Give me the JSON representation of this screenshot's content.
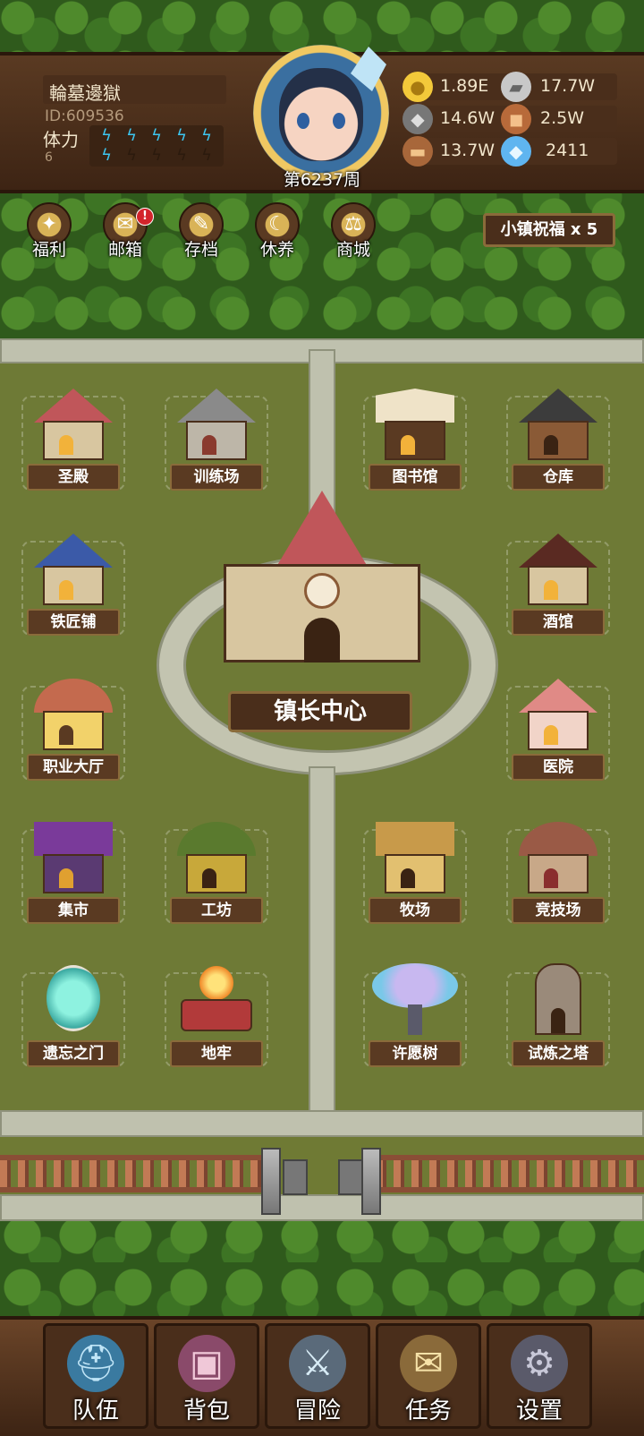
{
  "player": {
    "name": "輪墓邊獄",
    "id": "ID:609536",
    "stamina_label": "体力",
    "stamina_count": "6"
  },
  "week": "第6237周",
  "resources": [
    {
      "icon": "gold-coin-icon",
      "value": "1.89E"
    },
    {
      "icon": "iron-ingot-icon",
      "value": "17.7W"
    },
    {
      "icon": "stone-icon",
      "value": "14.6W"
    },
    {
      "icon": "leather-icon",
      "value": "2.5W"
    },
    {
      "icon": "wood-log-icon",
      "value": "13.7W"
    },
    {
      "icon": "crystal-icon",
      "value": "2411"
    }
  ],
  "menu": [
    {
      "label": "福利",
      "icon": "welfare-icon"
    },
    {
      "label": "邮箱",
      "icon": "mailbox-icon",
      "badge": "!"
    },
    {
      "label": "存档",
      "icon": "save-icon"
    },
    {
      "label": "休养",
      "icon": "rest-icon"
    },
    {
      "label": "商城",
      "icon": "shop-icon"
    }
  ],
  "blessing": "小镇祝福 x 5",
  "buildings": [
    {
      "label": "圣殿"
    },
    {
      "label": "训练场"
    },
    {
      "label": "图书馆"
    },
    {
      "label": "仓库"
    },
    {
      "label": "铁匠铺"
    },
    {
      "label": "酒馆"
    },
    {
      "label": "职业大厅"
    },
    {
      "label": "医院"
    },
    {
      "label": "集市"
    },
    {
      "label": "工坊"
    },
    {
      "label": "牧场"
    },
    {
      "label": "竞技场"
    },
    {
      "label": "遗忘之门"
    },
    {
      "label": "地牢"
    },
    {
      "label": "许愿树"
    },
    {
      "label": "试炼之塔"
    }
  ],
  "mayor_center": "镇长中心",
  "nav": [
    {
      "label": "队伍",
      "icon": "team-helmet-icon"
    },
    {
      "label": "背包",
      "icon": "backpack-icon"
    },
    {
      "label": "冒险",
      "icon": "crossed-swords-icon"
    },
    {
      "label": "任务",
      "icon": "quest-scroll-icon"
    },
    {
      "label": "设置",
      "icon": "settings-gear-icon"
    }
  ],
  "colors": {
    "wood_dark": "#4a2e1b",
    "grass": "#6e7a36",
    "road": "#bfc1ae",
    "stamina_bolt": "#3dc6f0",
    "badge_red": "#d3242b"
  }
}
